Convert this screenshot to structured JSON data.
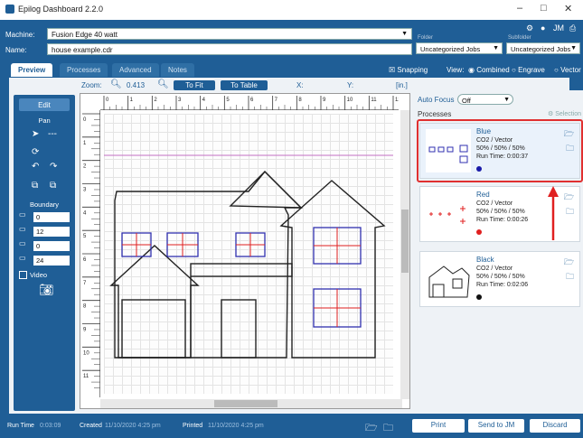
{
  "window": {
    "title": "Epilog Dashboard 2.2.0"
  },
  "machine": {
    "label": "Machine:",
    "value": "Fusion Edge 40 watt"
  },
  "name": {
    "label": "Name:",
    "value": "house example.cdr"
  },
  "folder": {
    "label": "Folder",
    "value": "Uncategorized Jobs"
  },
  "subfolder": {
    "label": "Subfolder",
    "value": "Uncategorized Jobs"
  },
  "tabs": [
    "Preview",
    "Processes",
    "Advanced",
    "Notes"
  ],
  "view": {
    "snapping": "Snapping",
    "view_label": "View:",
    "combined": "Combined",
    "engrave": "Engrave",
    "vector": "Vector"
  },
  "zoom": {
    "label": "Zoom:",
    "value": "0.413",
    "to_fit": "To Fit",
    "to_table": "To Table",
    "x": "X:",
    "y": "Y:",
    "unit": "[in.]"
  },
  "left_panel": {
    "edit": "Edit",
    "pan": "Pan",
    "boundary": "Boundary",
    "values": [
      "0",
      "12",
      "0",
      "24"
    ],
    "video": "Video"
  },
  "ruler": {
    "top": [
      "0",
      "1",
      "2",
      "3",
      "4",
      "5",
      "6",
      "7",
      "8",
      "9",
      "10",
      "11",
      "12"
    ],
    "left": [
      "0",
      "1",
      "2",
      "3",
      "4",
      "5",
      "6",
      "7",
      "8",
      "9",
      "10",
      "11"
    ]
  },
  "right_panel": {
    "auto_focus": "Auto Focus",
    "auto_focus_value": "Off",
    "processes": "Processes",
    "selection": "Selection",
    "items": [
      {
        "name": "Blue",
        "mode": "CO2 / Vector",
        "settings": "50% / 50% / 50%",
        "run_time": "Run Time: 0:00:37",
        "color": "#1a1aa8"
      },
      {
        "name": "Red",
        "mode": "CO2 / Vector",
        "settings": "50% / 50% / 50%",
        "run_time": "Run Time: 0:00:26",
        "color": "#e02020"
      },
      {
        "name": "Black",
        "mode": "CO2 / Vector",
        "settings": "50% / 50% / 50%",
        "run_time": "Run Time: 0:02:06",
        "color": "#111111"
      }
    ]
  },
  "status": {
    "run_time_label": "Run Time",
    "run_time": "0:03:09",
    "created_label": "Created",
    "created": "11/10/2020 4:25 pm",
    "printed_label": "Printed",
    "printed": "11/10/2020 4:25 pm",
    "print": "Print",
    "send": "Send to JM",
    "discard": "Discard"
  }
}
